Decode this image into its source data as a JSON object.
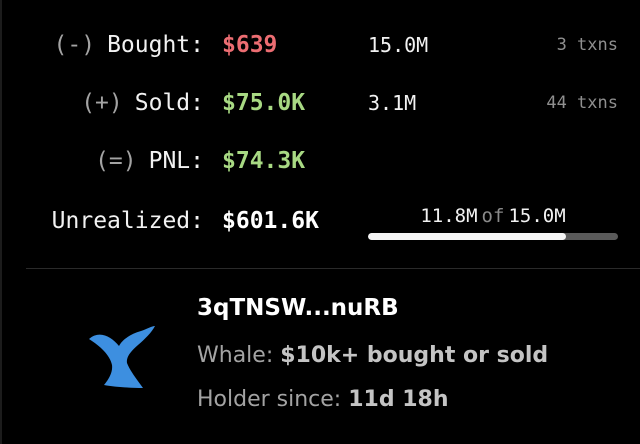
{
  "colors": {
    "background": "#000000",
    "loss": "#ec6d72",
    "gain": "#a8d983",
    "whale": "#3d8fe0"
  },
  "stats": {
    "bought": {
      "operator": "(-)",
      "label": "Bought:",
      "amount": "$639",
      "tokens": "15.0M",
      "txns": "3 txns"
    },
    "sold": {
      "operator": "(+)",
      "label": "Sold:",
      "amount": "$75.0K",
      "tokens": "3.1M",
      "txns": "44 txns"
    },
    "pnl": {
      "operator": "(=)",
      "label": "PNL:",
      "amount": "$74.3K"
    },
    "unrealized": {
      "label": "Unrealized:",
      "amount": "$601.6K",
      "held": "11.8M",
      "of_word": "of",
      "total": "15.0M",
      "progress_fraction": 0.79
    }
  },
  "wallet": {
    "icon": "whale-tail-icon",
    "address": "3qTNSW...nuRB",
    "category_label": "Whale:",
    "category_value": "$10k+ bought or sold",
    "holder_label": "Holder since:",
    "holder_value": "11d 18h"
  }
}
